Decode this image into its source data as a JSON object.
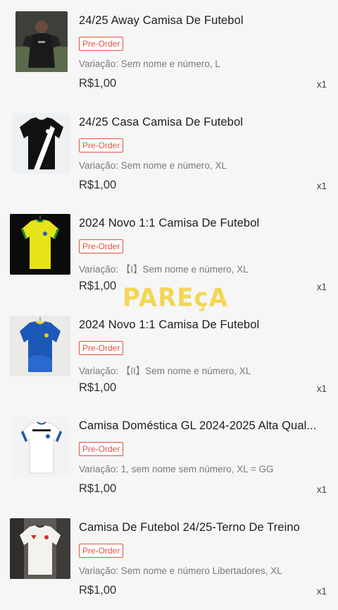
{
  "orders": [
    {
      "title": "24/25 Away Camisa De Futebol",
      "badge": "Pre-Order",
      "variation": "Variação: Sem nome e número, L",
      "price": "R$1,00",
      "qty": "x1",
      "thumb_icon": "player-photo-dark-jersey"
    },
    {
      "title": "24/25 Casa Camisa De Futebol",
      "badge": "Pre-Order",
      "variation": "Variação: Sem nome e número, XL",
      "price": "R$1,00",
      "qty": "x1",
      "thumb_icon": "black-white-sash-jersey"
    },
    {
      "title": "2024 Novo 1:1 Camisa De Futebol",
      "badge": "Pre-Order",
      "variation": "Variação: 【I】Sem nome e número, XL",
      "price": "R$1,00",
      "qty": "x1",
      "thumb_icon": "yellow-green-jersey"
    },
    {
      "title": "2024 Novo 1:1 Camisa De Futebol",
      "badge": "Pre-Order",
      "variation": "Variação: 【II】Sem nome e número, XL",
      "price": "R$1,00",
      "qty": "x1",
      "thumb_icon": "blue-jersey"
    },
    {
      "title": "Camisa Doméstica GL 2024-2025 Alta Qual...",
      "badge": "Pre-Order",
      "variation": "Variação: 1,  sem nome sem número, XL = GG",
      "price": "R$1,00",
      "qty": "x1",
      "thumb_icon": "white-blue-jersey"
    },
    {
      "title": "Camisa De Futebol 24/25-Terno De Treino",
      "badge": "Pre-Order",
      "variation": "Variação: Sem nome e número Libertadores, XL",
      "price": "R$1,00",
      "qty": "x1",
      "thumb_icon": "white-training-jersey"
    }
  ],
  "watermark": "PAREçA",
  "colors": {
    "badge": "#e0533f",
    "watermark": "#f2d13a",
    "background": "#f6f6f6"
  }
}
